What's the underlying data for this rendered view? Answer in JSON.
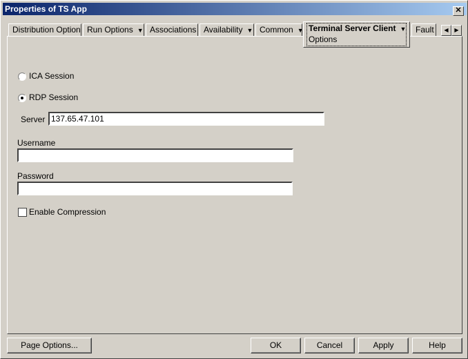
{
  "window": {
    "title": "Properties of TS App",
    "close": "✕"
  },
  "tabs": [
    {
      "label": "Distribution Options",
      "dropdown": false
    },
    {
      "label": "Run Options",
      "dropdown": true
    },
    {
      "label": "Associations",
      "dropdown": false
    },
    {
      "label": "Availability",
      "dropdown": true
    },
    {
      "label": "Common",
      "dropdown": true
    },
    {
      "label": "Terminal Server Client",
      "sublabel": "Options",
      "dropdown": true,
      "active": true
    },
    {
      "label": "Fault",
      "dropdown": false
    }
  ],
  "tab_nav": {
    "left": "◀",
    "right": "▶"
  },
  "arrow": "▼",
  "form": {
    "ica_label": "ICA Session",
    "ica_selected": false,
    "rdp_label": "RDP Session",
    "rdp_selected": true,
    "server_label": "Server",
    "server_value": "137.65.47.101",
    "username_label": "Username",
    "username_value": "",
    "password_label": "Password",
    "password_value": "",
    "compression_label": "Enable Compression",
    "compression_checked": false
  },
  "buttons": {
    "page_options": "Page Options...",
    "ok": "OK",
    "cancel": "Cancel",
    "apply": "Apply",
    "help": "Help"
  }
}
